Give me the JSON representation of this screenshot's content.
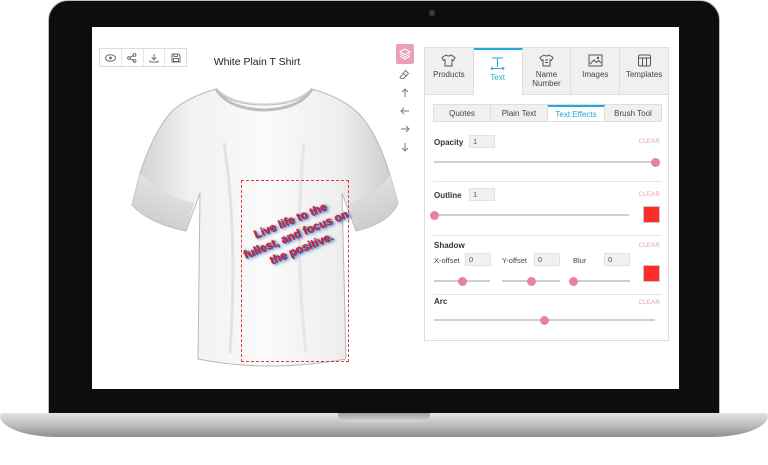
{
  "product": {
    "title": "White Plain T Shirt",
    "design_text": "Live life to the fullest, and focus on the positive."
  },
  "toolbar": {
    "icons": [
      "eye-icon",
      "share-icon",
      "download-icon",
      "save-icon"
    ]
  },
  "side_tools": [
    "layers-icon",
    "eraser-icon",
    "arrow-up-icon",
    "arrow-left-icon",
    "arrow-right-icon",
    "arrow-down-icon"
  ],
  "main_tabs": [
    {
      "label": "Products",
      "icon": "tshirt-icon"
    },
    {
      "label": "Text",
      "icon": "text-icon",
      "active": true
    },
    {
      "label": "Name Number",
      "icon": "tshirt-number-icon"
    },
    {
      "label": "Images",
      "icon": "image-icon"
    },
    {
      "label": "Templates",
      "icon": "templates-icon"
    }
  ],
  "sub_tabs": [
    {
      "label": "Quotes"
    },
    {
      "label": "Plain Text"
    },
    {
      "label": "Text Effects",
      "active": true
    },
    {
      "label": "Brush Tool"
    }
  ],
  "effects": {
    "clear_label": "CLEAR",
    "opacity": {
      "label": "Opacity",
      "value": "1",
      "slider_level": 1.0
    },
    "outline": {
      "label": "Outline",
      "value": "1",
      "slider_level": 0.0,
      "color": "#ff2a2a"
    },
    "shadow": {
      "label": "Shadow",
      "x_offset": {
        "label": "X-offset",
        "value": "0",
        "slider_level": 0.5
      },
      "y_offset": {
        "label": "Y-offset",
        "value": "0",
        "slider_level": 0.5
      },
      "blur": {
        "label": "Blur",
        "value": "0",
        "slider_level": 0.0
      },
      "color": "#ff2a2a"
    },
    "arc": {
      "label": "Arc",
      "slider_level": 0.5
    }
  },
  "colors": {
    "accent": "#27a9d4",
    "slider_knob": "#e6839f",
    "design_text": "#e41e26"
  }
}
